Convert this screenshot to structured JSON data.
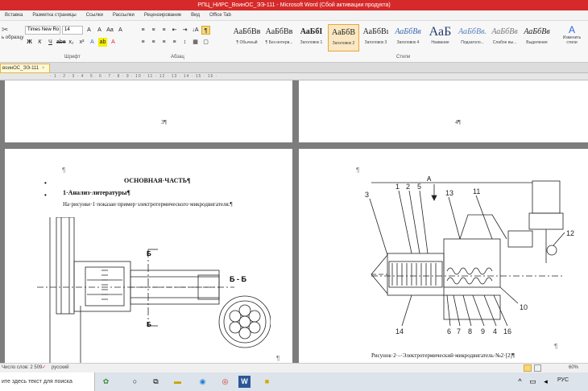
{
  "window": {
    "title": "РПЦ_НИРС_ВоинОС_ЭЭ-111 - Microsoft Word (Сбой активации продукта)"
  },
  "ribbon_tabs": [
    "Вставка",
    "Разметка страницы",
    "Ссылки",
    "Рассылки",
    "Рецензирование",
    "Вид",
    "Office Tab"
  ],
  "clipboard": {
    "partial_label": "ь образцу"
  },
  "font": {
    "name": "Times New Ro",
    "size": "14",
    "group_label": "Шрифт",
    "buttons": {
      "bold": "Ж",
      "italic": "К",
      "underline": "Ч",
      "strike": "abe",
      "sub": "x₂",
      "sup": "x²",
      "grow": "A",
      "shrink": "A",
      "change_case": "Aa",
      "clear": "A",
      "color": "A",
      "highlight": "ab",
      "border": "A"
    }
  },
  "paragraph": {
    "group_label": "Абзац",
    "pilcrow": "¶",
    "buttons": {
      "bullets": "≡",
      "numbering": "≡",
      "multilevel": "≡",
      "outdent": "⇤",
      "indent": "⇥",
      "sort": "↓А",
      "align_left": "≡",
      "center": "≡",
      "right": "≡",
      "justify": "≡",
      "spacing": "↕",
      "shading": "▦",
      "borders": "▢"
    }
  },
  "styles": {
    "group_label": "Стили",
    "items": [
      {
        "sample": "АаБбВв",
        "name": "¶ Обычный"
      },
      {
        "sample": "АаБбВв",
        "name": "¶ Без интерв..."
      },
      {
        "sample": "АаБбI",
        "name": "Заголовок 1"
      },
      {
        "sample": "АаБбВ",
        "name": "Заголовок 2"
      },
      {
        "sample": "АаБбВı",
        "name": "Заголовок 3"
      },
      {
        "sample": "АаБбВв",
        "name": "Заголовок 4"
      },
      {
        "sample": "АаБ",
        "name": "Название"
      },
      {
        "sample": "АаБбВв.",
        "name": "Подзаголо..."
      },
      {
        "sample": "АаБбВв",
        "name": "Слабое вы..."
      },
      {
        "sample": "АаБбВв",
        "name": "Выделение"
      }
    ],
    "change_styles": "Изменить стили"
  },
  "document_tab": {
    "name": "воинОС_ЭЭ-111"
  },
  "ruler": {
    "text": "· 1 · 2 · 3 · 4 · 5 · 6 · 7 · 8 · 9 · 10 · 11 · 12 · 13 · 14 · 15 · 16 ·"
  },
  "pages": {
    "page3": {
      "number": "3¶"
    },
    "page4": {
      "number": "4¶"
    },
    "left": {
      "pilcrow": "¶",
      "heading": "ОСНОВНАЯ·ЧАСТЬ¶",
      "section": "1·Анализ·литературы¶",
      "paragraph": "На·рисунке·1·показан·пример·электротермического·микродвигателя.¶",
      "section_label": "Б - Б",
      "cut_label_1": "Б",
      "cut_label_2": "Б",
      "end_pilcrow": "¶"
    },
    "right": {
      "pilcrow": "¶",
      "arrow_label": "А",
      "caption": "Рисунок·2·–·Электротермический·микродвигатель·№2·[2]¶",
      "end_pilcrow": "¶",
      "callouts": [
        "3",
        "1",
        "2",
        "5",
        "13",
        "11",
        "12",
        "10",
        "14",
        "6",
        "7",
        "8",
        "9",
        "4",
        "16"
      ]
    }
  },
  "status": {
    "words": "Число слов: 2 509",
    "language": "русский",
    "zoom": "60%"
  },
  "taskbar": {
    "search": "ите здесь текст для поиска",
    "lang": "РУС"
  }
}
